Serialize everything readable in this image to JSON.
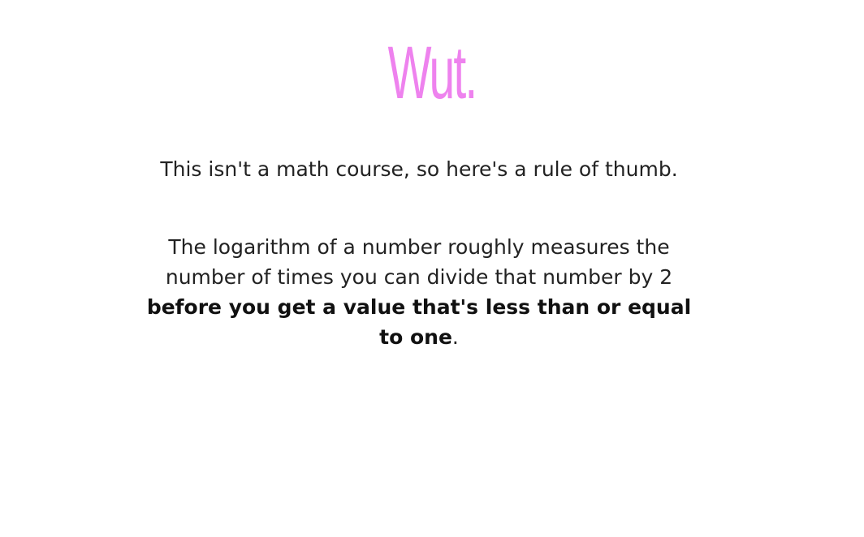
{
  "slide": {
    "title": "Wut.",
    "title_color": "#ee82ee",
    "intro": "This isn't a math course, so here's a rule of thumb.",
    "explanation": {
      "plain": "The logarithm of a number roughly measures the number of times you can divide that number by 2 ",
      "bold": "before you get a value that's less than or equal to one",
      "end": "."
    }
  }
}
